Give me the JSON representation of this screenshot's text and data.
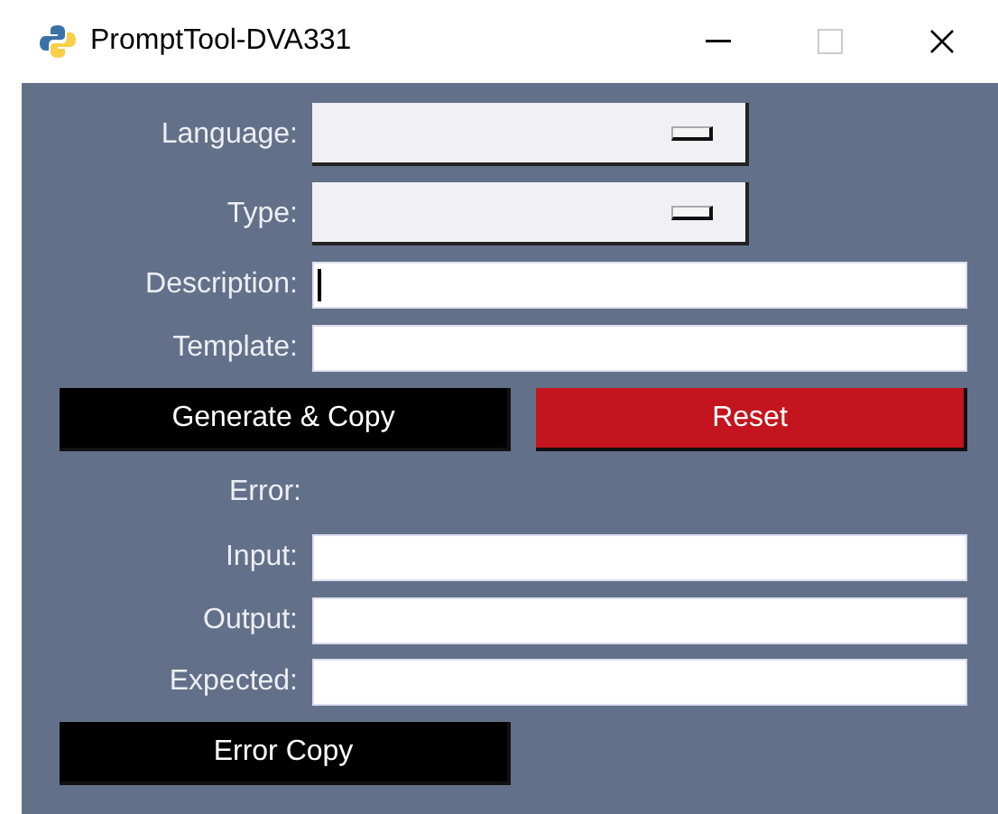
{
  "window": {
    "title": "PromptTool-DVA331"
  },
  "form": [
    {
      "kind": "dropdown",
      "label": "Language:"
    },
    {
      "kind": "dropdown",
      "label": "Type:"
    },
    {
      "kind": "text",
      "label": "Description:",
      "focused": true
    },
    {
      "kind": "text",
      "label": "Template:"
    }
  ],
  "actions": [
    {
      "label": "Generate & Copy",
      "kind": "primary"
    },
    {
      "label": "Reset",
      "kind": "danger"
    }
  ],
  "error_section": {
    "heading": "Error:",
    "fields": [
      {
        "label": "Input:"
      },
      {
        "label": "Output:"
      },
      {
        "label": "Expected:"
      }
    ],
    "button": "Error Copy"
  }
}
